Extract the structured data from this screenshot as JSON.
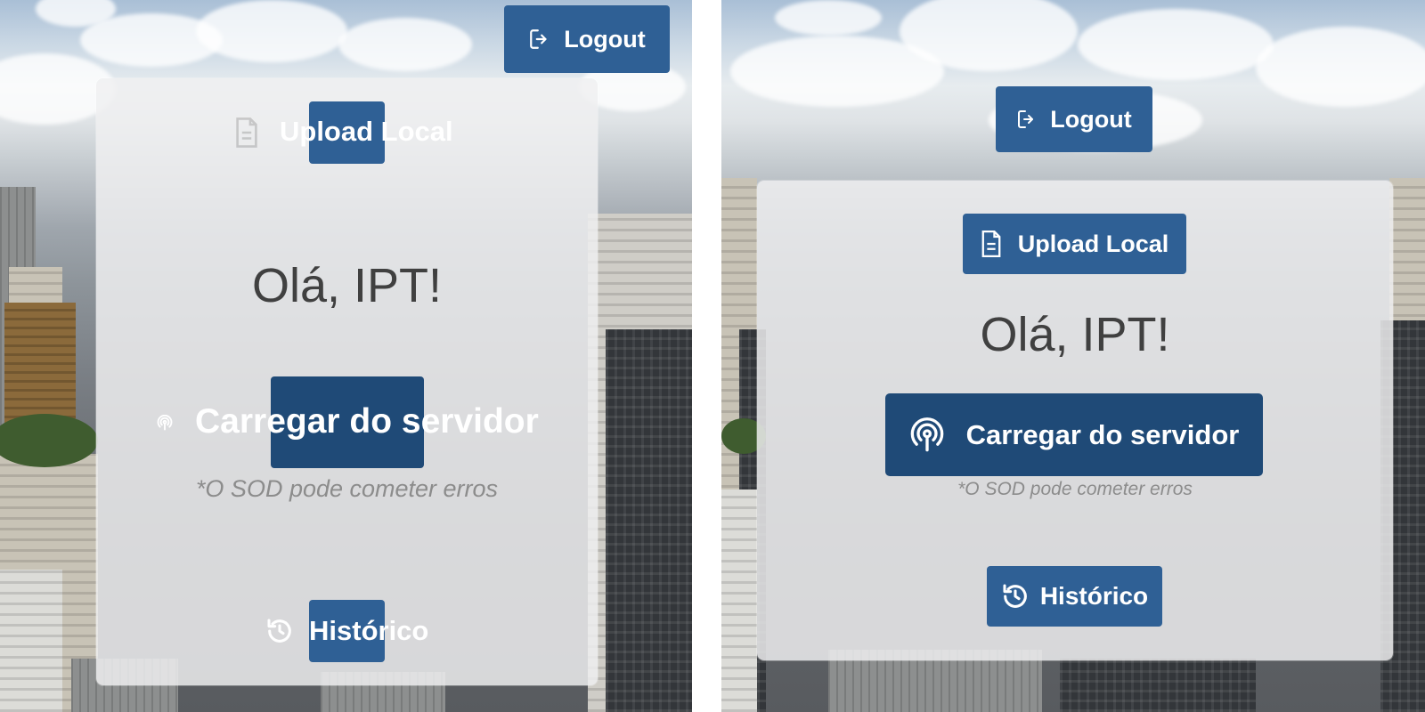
{
  "left_view": {
    "logout_label": "Logout",
    "upload_label": "Upload Local",
    "greeting": "Olá, IPT!",
    "server_label": "Carregar do servidor",
    "disclaimer": "*O SOD pode cometer erros",
    "history_label": "Histórico"
  },
  "right_view": {
    "logout_label": "Logout",
    "upload_label": "Upload Local",
    "greeting": "Olá, IPT!",
    "server_label": "Carregar do servidor",
    "disclaimer": "*O SOD pode cometer erros",
    "history_label": "Histórico"
  },
  "icons": {
    "logout": "logout-icon",
    "upload": "document-icon",
    "server": "broadcast-icon",
    "history": "history-icon"
  },
  "colors": {
    "button_primary": "#2f6095",
    "button_dark": "#1f4a77",
    "greeting_text": "#404040",
    "disclaimer_text": "#8c8c8c",
    "card_background": "#f0f0f1"
  }
}
